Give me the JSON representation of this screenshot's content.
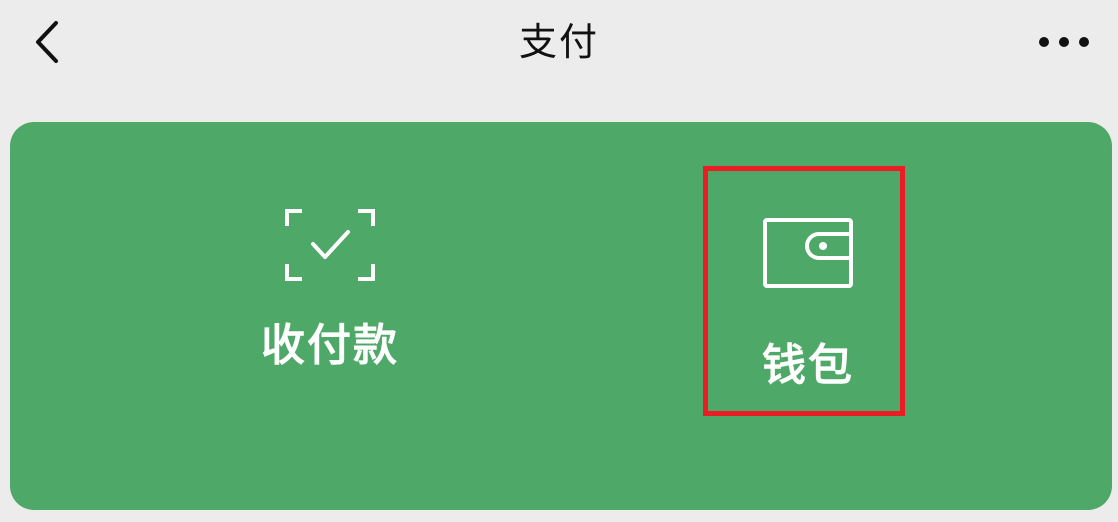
{
  "header": {
    "title": "支付",
    "back_icon": "chevron-left-icon",
    "more_icon": "more-horizontal-icon"
  },
  "actions": [
    {
      "label": "收付款",
      "icon": "scan-check-icon"
    },
    {
      "label": "钱包",
      "icon": "wallet-icon"
    }
  ],
  "colors": {
    "background": "#ececec",
    "card": "#4ea968",
    "highlight": "#ec1c24",
    "text": "#111111",
    "card_text": "#ffffff"
  }
}
